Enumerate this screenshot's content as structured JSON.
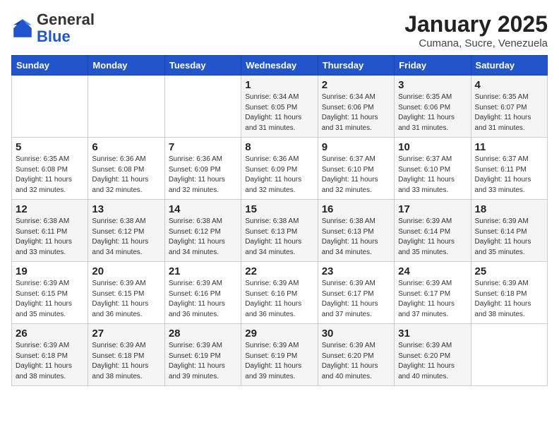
{
  "header": {
    "logo_general": "General",
    "logo_blue": "Blue",
    "month_title": "January 2025",
    "subtitle": "Cumana, Sucre, Venezuela"
  },
  "days_of_week": [
    "Sunday",
    "Monday",
    "Tuesday",
    "Wednesday",
    "Thursday",
    "Friday",
    "Saturday"
  ],
  "weeks": [
    [
      {
        "day": "",
        "sunrise": "",
        "sunset": "",
        "daylight": ""
      },
      {
        "day": "",
        "sunrise": "",
        "sunset": "",
        "daylight": ""
      },
      {
        "day": "",
        "sunrise": "",
        "sunset": "",
        "daylight": ""
      },
      {
        "day": "1",
        "sunrise": "Sunrise: 6:34 AM",
        "sunset": "Sunset: 6:05 PM",
        "daylight": "Daylight: 11 hours and 31 minutes."
      },
      {
        "day": "2",
        "sunrise": "Sunrise: 6:34 AM",
        "sunset": "Sunset: 6:06 PM",
        "daylight": "Daylight: 11 hours and 31 minutes."
      },
      {
        "day": "3",
        "sunrise": "Sunrise: 6:35 AM",
        "sunset": "Sunset: 6:06 PM",
        "daylight": "Daylight: 11 hours and 31 minutes."
      },
      {
        "day": "4",
        "sunrise": "Sunrise: 6:35 AM",
        "sunset": "Sunset: 6:07 PM",
        "daylight": "Daylight: 11 hours and 31 minutes."
      }
    ],
    [
      {
        "day": "5",
        "sunrise": "Sunrise: 6:35 AM",
        "sunset": "Sunset: 6:08 PM",
        "daylight": "Daylight: 11 hours and 32 minutes."
      },
      {
        "day": "6",
        "sunrise": "Sunrise: 6:36 AM",
        "sunset": "Sunset: 6:08 PM",
        "daylight": "Daylight: 11 hours and 32 minutes."
      },
      {
        "day": "7",
        "sunrise": "Sunrise: 6:36 AM",
        "sunset": "Sunset: 6:09 PM",
        "daylight": "Daylight: 11 hours and 32 minutes."
      },
      {
        "day": "8",
        "sunrise": "Sunrise: 6:36 AM",
        "sunset": "Sunset: 6:09 PM",
        "daylight": "Daylight: 11 hours and 32 minutes."
      },
      {
        "day": "9",
        "sunrise": "Sunrise: 6:37 AM",
        "sunset": "Sunset: 6:10 PM",
        "daylight": "Daylight: 11 hours and 32 minutes."
      },
      {
        "day": "10",
        "sunrise": "Sunrise: 6:37 AM",
        "sunset": "Sunset: 6:10 PM",
        "daylight": "Daylight: 11 hours and 33 minutes."
      },
      {
        "day": "11",
        "sunrise": "Sunrise: 6:37 AM",
        "sunset": "Sunset: 6:11 PM",
        "daylight": "Daylight: 11 hours and 33 minutes."
      }
    ],
    [
      {
        "day": "12",
        "sunrise": "Sunrise: 6:38 AM",
        "sunset": "Sunset: 6:11 PM",
        "daylight": "Daylight: 11 hours and 33 minutes."
      },
      {
        "day": "13",
        "sunrise": "Sunrise: 6:38 AM",
        "sunset": "Sunset: 6:12 PM",
        "daylight": "Daylight: 11 hours and 34 minutes."
      },
      {
        "day": "14",
        "sunrise": "Sunrise: 6:38 AM",
        "sunset": "Sunset: 6:12 PM",
        "daylight": "Daylight: 11 hours and 34 minutes."
      },
      {
        "day": "15",
        "sunrise": "Sunrise: 6:38 AM",
        "sunset": "Sunset: 6:13 PM",
        "daylight": "Daylight: 11 hours and 34 minutes."
      },
      {
        "day": "16",
        "sunrise": "Sunrise: 6:38 AM",
        "sunset": "Sunset: 6:13 PM",
        "daylight": "Daylight: 11 hours and 34 minutes."
      },
      {
        "day": "17",
        "sunrise": "Sunrise: 6:39 AM",
        "sunset": "Sunset: 6:14 PM",
        "daylight": "Daylight: 11 hours and 35 minutes."
      },
      {
        "day": "18",
        "sunrise": "Sunrise: 6:39 AM",
        "sunset": "Sunset: 6:14 PM",
        "daylight": "Daylight: 11 hours and 35 minutes."
      }
    ],
    [
      {
        "day": "19",
        "sunrise": "Sunrise: 6:39 AM",
        "sunset": "Sunset: 6:15 PM",
        "daylight": "Daylight: 11 hours and 35 minutes."
      },
      {
        "day": "20",
        "sunrise": "Sunrise: 6:39 AM",
        "sunset": "Sunset: 6:15 PM",
        "daylight": "Daylight: 11 hours and 36 minutes."
      },
      {
        "day": "21",
        "sunrise": "Sunrise: 6:39 AM",
        "sunset": "Sunset: 6:16 PM",
        "daylight": "Daylight: 11 hours and 36 minutes."
      },
      {
        "day": "22",
        "sunrise": "Sunrise: 6:39 AM",
        "sunset": "Sunset: 6:16 PM",
        "daylight": "Daylight: 11 hours and 36 minutes."
      },
      {
        "day": "23",
        "sunrise": "Sunrise: 6:39 AM",
        "sunset": "Sunset: 6:17 PM",
        "daylight": "Daylight: 11 hours and 37 minutes."
      },
      {
        "day": "24",
        "sunrise": "Sunrise: 6:39 AM",
        "sunset": "Sunset: 6:17 PM",
        "daylight": "Daylight: 11 hours and 37 minutes."
      },
      {
        "day": "25",
        "sunrise": "Sunrise: 6:39 AM",
        "sunset": "Sunset: 6:18 PM",
        "daylight": "Daylight: 11 hours and 38 minutes."
      }
    ],
    [
      {
        "day": "26",
        "sunrise": "Sunrise: 6:39 AM",
        "sunset": "Sunset: 6:18 PM",
        "daylight": "Daylight: 11 hours and 38 minutes."
      },
      {
        "day": "27",
        "sunrise": "Sunrise: 6:39 AM",
        "sunset": "Sunset: 6:18 PM",
        "daylight": "Daylight: 11 hours and 38 minutes."
      },
      {
        "day": "28",
        "sunrise": "Sunrise: 6:39 AM",
        "sunset": "Sunset: 6:19 PM",
        "daylight": "Daylight: 11 hours and 39 minutes."
      },
      {
        "day": "29",
        "sunrise": "Sunrise: 6:39 AM",
        "sunset": "Sunset: 6:19 PM",
        "daylight": "Daylight: 11 hours and 39 minutes."
      },
      {
        "day": "30",
        "sunrise": "Sunrise: 6:39 AM",
        "sunset": "Sunset: 6:20 PM",
        "daylight": "Daylight: 11 hours and 40 minutes."
      },
      {
        "day": "31",
        "sunrise": "Sunrise: 6:39 AM",
        "sunset": "Sunset: 6:20 PM",
        "daylight": "Daylight: 11 hours and 40 minutes."
      },
      {
        "day": "",
        "sunrise": "",
        "sunset": "",
        "daylight": ""
      }
    ]
  ]
}
